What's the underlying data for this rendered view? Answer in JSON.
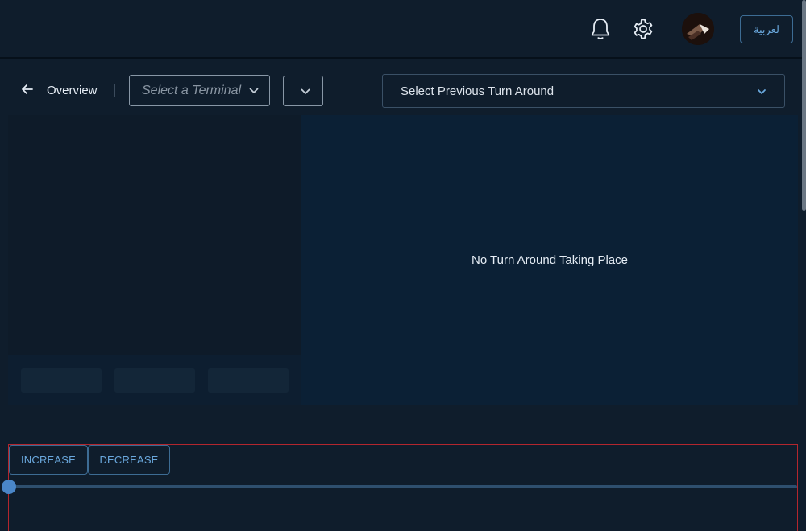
{
  "header": {
    "language_button": "لعربية",
    "icons": [
      "bell-icon",
      "gear-icon"
    ]
  },
  "toolbar": {
    "back_label": "Overview",
    "terminal_placeholder": "Select a Terminal",
    "previous_turnaround_label": "Select Previous Turn Around"
  },
  "main": {
    "empty_message": "No Turn Around Taking Place"
  },
  "controls": {
    "increase_label": "INCREASE",
    "decrease_label": "DECREASE",
    "slider_value": 0
  },
  "colors": {
    "background": "#0f1d2c",
    "accent": "#6aa8dd",
    "slider_thumb": "#4a86c8",
    "outline_red": "#b3262e"
  }
}
